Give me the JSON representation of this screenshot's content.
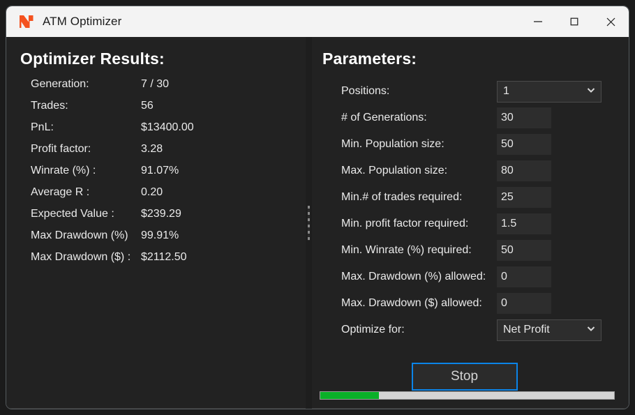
{
  "window": {
    "title": "ATM Optimizer",
    "logo_icon": "ninjatrader-nt-logo-icon",
    "minimize_icon": "minimize-icon",
    "maximize_icon": "maximize-icon",
    "close_icon": "close-icon",
    "accent_blue": "#0b84e8",
    "logo_color": "#f4511e",
    "progress_green": "#0ab028"
  },
  "results": {
    "title": "Optimizer Results:",
    "rows": [
      {
        "label": "Generation:",
        "value": "7 / 30"
      },
      {
        "label": "Trades:",
        "value": "56"
      },
      {
        "label": "PnL:",
        "value": "$13400.00"
      },
      {
        "label": "Profit factor:",
        "value": "3.28"
      },
      {
        "label": "Winrate (%) :",
        "value": "91.07%"
      },
      {
        "label": "Average R :",
        "value": "0.20"
      },
      {
        "label": "Expected Value :",
        "value": "$239.29"
      },
      {
        "label": "Max Drawdown (%)",
        "value": "99.91%"
      },
      {
        "label": "Max Drawdown ($) :",
        "value": "$2112.50"
      }
    ]
  },
  "parameters": {
    "title": "Parameters:",
    "rows": [
      {
        "label": "Positions:",
        "value": "1",
        "control": "combo"
      },
      {
        "label": "# of Generations:",
        "value": "30",
        "control": "input"
      },
      {
        "label": "Min. Population size:",
        "value": "50",
        "control": "input"
      },
      {
        "label": "Max. Population size:",
        "value": "80",
        "control": "input"
      },
      {
        "label": "Min.# of trades required:",
        "value": "25",
        "control": "input"
      },
      {
        "label": "Min. profit factor required:",
        "value": "1.5",
        "control": "input"
      },
      {
        "label": "Min. Winrate (%) required:",
        "value": "50",
        "control": "input"
      },
      {
        "label": "Max. Drawdown (%) allowed:",
        "value": "0",
        "control": "input"
      },
      {
        "label": "Max. Drawdown ($) allowed:",
        "value": "0",
        "control": "input"
      },
      {
        "label": "Optimize for:",
        "value": "Net Profit",
        "control": "combo"
      }
    ],
    "stop_button_label": "Stop",
    "progress_percent": 20
  }
}
